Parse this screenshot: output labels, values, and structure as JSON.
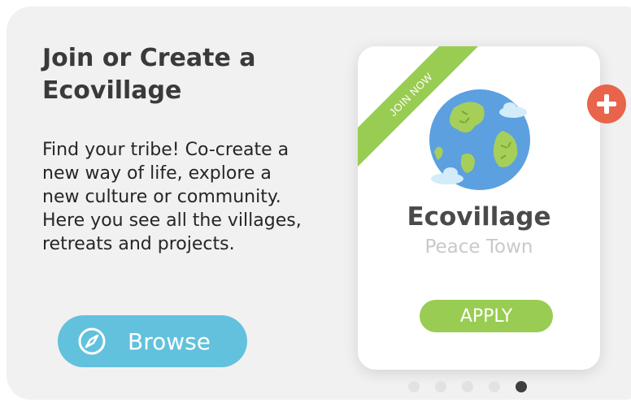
{
  "intro": {
    "title": "Join or Create a Ecovillage",
    "description": "Find your tribe! Co-create a new way of life, explore a new culture or community. Here you see all the villages, retreats and projects."
  },
  "browse_button": {
    "label": "Browse",
    "icon": "compass-icon"
  },
  "card": {
    "ribbon": "JOIN NOW",
    "title": "Ecovillage",
    "subtitle": "Peace Town",
    "apply_label": "APPLY",
    "image": "earth-globe-icon"
  },
  "add_button": {
    "icon": "plus-icon"
  },
  "carousel": {
    "count": 5,
    "active_index": 4
  },
  "colors": {
    "panel_background": "#f1f1f1",
    "browse_button": "#62c1dd",
    "accent_green": "#99cc52",
    "add_button": "#e8644a",
    "dot_inactive": "#e2e2e2",
    "dot_active": "#3f3f3f"
  }
}
